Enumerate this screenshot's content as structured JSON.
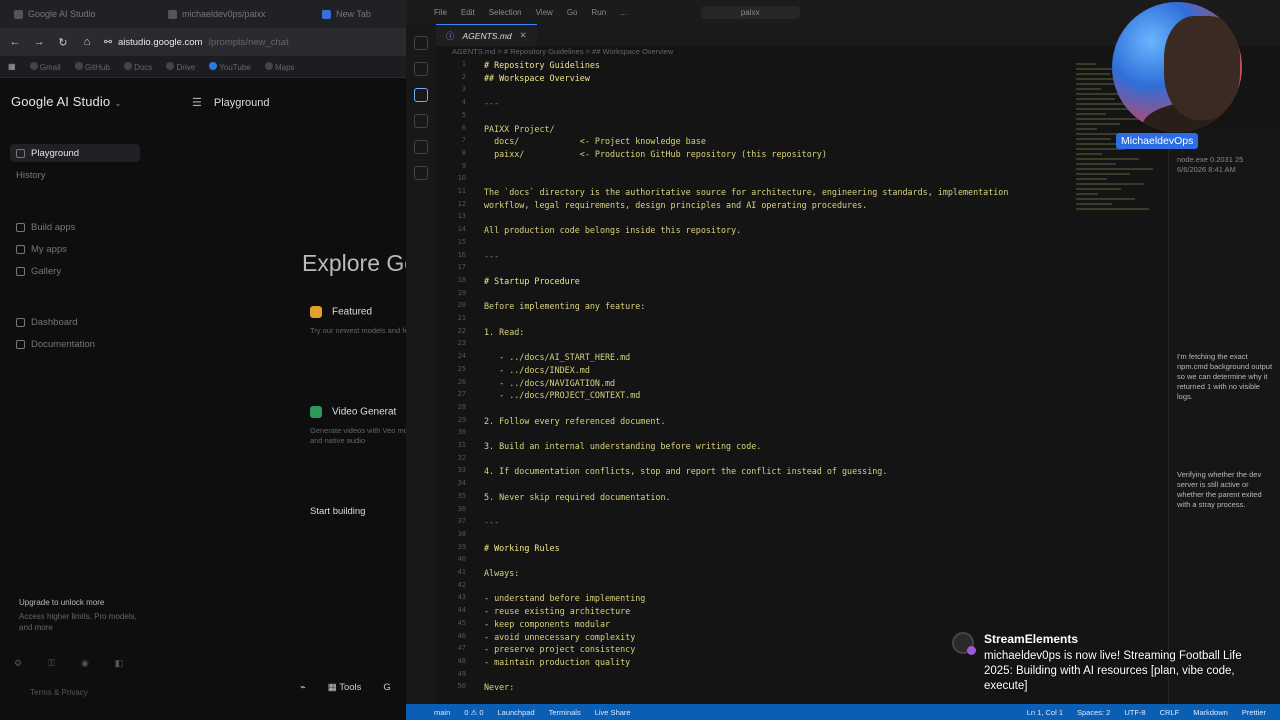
{
  "browser": {
    "tabs": [
      "Google AI Studio",
      "michaeldev0ps/paixx",
      "New Tab"
    ],
    "url": "aistudio.google.com",
    "url_dim": "/prompts/new_chat",
    "bookmarks": [
      "Gmail",
      "GitHub",
      "Docs",
      "Drive",
      "YouTube",
      "Maps"
    ]
  },
  "studio": {
    "logo": "Google AI Studio",
    "sidebar": [
      {
        "label": "Playground",
        "active": true
      },
      {
        "label": "History",
        "active": false
      },
      {
        "label": "Build apps",
        "active": false
      },
      {
        "label": "My apps",
        "active": false
      },
      {
        "label": "Gallery",
        "active": false
      },
      {
        "label": "Dashboard",
        "active": false
      },
      {
        "label": "Documentation",
        "active": false
      }
    ],
    "upgrade_title": "Upgrade to unlock more",
    "upgrade_sub": "Access higher limits, Pro models, and more",
    "footer": "Terms & Privacy",
    "page_title": "Playground",
    "explore_title": "Explore Go",
    "cards": [
      {
        "title": "Featured",
        "desc": "Try our newest models and features",
        "color": "#e0a030"
      },
      {
        "title": "Video Generat",
        "desc": "Generate videos with Veo models and native audio",
        "color": "#2e9a5a"
      }
    ],
    "start_building": "Start building",
    "tools_label": "Tools",
    "tools_extra": "G"
  },
  "vscode": {
    "menu": [
      "File",
      "Edit",
      "Selection",
      "View",
      "Go",
      "Run",
      "...",
      "paixx"
    ],
    "tab_label": "AGENTS.md",
    "tab_close": "✕",
    "breadcrumb": "AGENTS.md  >  # Repository Guidelines  >  ## Workspace Overview",
    "code_lines": [
      {
        "n": "1",
        "t": "# Repository Guidelines",
        "k": "head"
      },
      {
        "n": "2",
        "t": "## Workspace Overview",
        "k": "head"
      },
      {
        "n": "3",
        "t": "",
        "k": ""
      },
      {
        "n": "4",
        "t": "---",
        "k": "dim"
      },
      {
        "n": "5",
        "t": "",
        "k": ""
      },
      {
        "n": "6",
        "t": "PAIXX Project/",
        "k": ""
      },
      {
        "n": "7",
        "t": "  docs/            <- Project knowledge base",
        "k": ""
      },
      {
        "n": "8",
        "t": "  paixx/           <- Production GitHub repository (this repository)",
        "k": ""
      },
      {
        "n": "9",
        "t": "",
        "k": ""
      },
      {
        "n": "10",
        "t": "",
        "k": ""
      },
      {
        "n": "11",
        "t": "The `docs` directory is the authoritative source for architecture, engineering standards, implementation",
        "k": ""
      },
      {
        "n": "12",
        "t": "workflow, legal requirements, design principles and AI operating procedures.",
        "k": ""
      },
      {
        "n": "13",
        "t": "",
        "k": ""
      },
      {
        "n": "14",
        "t": "All production code belongs inside this repository.",
        "k": ""
      },
      {
        "n": "15",
        "t": "",
        "k": ""
      },
      {
        "n": "16",
        "t": "---",
        "k": "dim"
      },
      {
        "n": "17",
        "t": "",
        "k": ""
      },
      {
        "n": "18",
        "t": "# Startup Procedure",
        "k": "head"
      },
      {
        "n": "19",
        "t": "",
        "k": ""
      },
      {
        "n": "20",
        "t": "Before implementing any feature:",
        "k": ""
      },
      {
        "n": "21",
        "t": "",
        "k": ""
      },
      {
        "n": "22",
        "t": "1. Read:",
        "k": ""
      },
      {
        "n": "23",
        "t": "",
        "k": ""
      },
      {
        "n": "24",
        "t": "   - ../docs/AI_START_HERE.md",
        "k": ""
      },
      {
        "n": "25",
        "t": "   - ../docs/INDEX.md",
        "k": ""
      },
      {
        "n": "26",
        "t": "   - ../docs/NAVIGATION.md",
        "k": ""
      },
      {
        "n": "27",
        "t": "   - ../docs/PROJECT_CONTEXT.md",
        "k": ""
      },
      {
        "n": "28",
        "t": "",
        "k": ""
      },
      {
        "n": "29",
        "t": "2. Follow every referenced document.",
        "k": ""
      },
      {
        "n": "30",
        "t": "",
        "k": ""
      },
      {
        "n": "31",
        "t": "3. Build an internal understanding before writing code.",
        "k": ""
      },
      {
        "n": "32",
        "t": "",
        "k": ""
      },
      {
        "n": "33",
        "t": "4. If documentation conflicts, stop and report the conflict instead of guessing.",
        "k": ""
      },
      {
        "n": "34",
        "t": "",
        "k": ""
      },
      {
        "n": "35",
        "t": "5. Never skip required documentation.",
        "k": ""
      },
      {
        "n": "36",
        "t": "",
        "k": ""
      },
      {
        "n": "37",
        "t": "---",
        "k": "dim"
      },
      {
        "n": "38",
        "t": "",
        "k": ""
      },
      {
        "n": "39",
        "t": "# Working Rules",
        "k": "head"
      },
      {
        "n": "40",
        "t": "",
        "k": ""
      },
      {
        "n": "41",
        "t": "Always:",
        "k": ""
      },
      {
        "n": "42",
        "t": "",
        "k": ""
      },
      {
        "n": "43",
        "t": "- understand before implementing",
        "k": ""
      },
      {
        "n": "44",
        "t": "- reuse existing architecture",
        "k": ""
      },
      {
        "n": "45",
        "t": "- keep components modular",
        "k": ""
      },
      {
        "n": "46",
        "t": "- avoid unnecessary complexity",
        "k": ""
      },
      {
        "n": "47",
        "t": "- preserve project consistency",
        "k": ""
      },
      {
        "n": "48",
        "t": "- maintain production quality",
        "k": ""
      },
      {
        "n": "49",
        "t": "",
        "k": ""
      },
      {
        "n": "50",
        "t": "Never:",
        "k": ""
      }
    ],
    "panel_top": "node.exe 0.2031 25 6/6/2026 8:41 AM",
    "panel_mid": "I'm fetching the exact npm.cmd background output so we can determine why it returned 1 with no visible logs.",
    "panel_low": "Verifying whether the dev server is still active or whether the parent exited with a stray process.",
    "status_left": [
      "main",
      "0 ⚠ 0",
      "Launchpad",
      "Terminals",
      "Live Share"
    ],
    "status_right": [
      "Ln 1, Col 1",
      "Spaces: 2",
      "UTF-8",
      "CRLF",
      "Markdown",
      "Prettier"
    ]
  },
  "webcam": {
    "label": "MichaeldevOps"
  },
  "stream": {
    "title": "StreamElements",
    "message": "michaeldev0ps is now live! Streaming Football Life 2025: Building with AI resources [plan, vibe code, execute]"
  }
}
